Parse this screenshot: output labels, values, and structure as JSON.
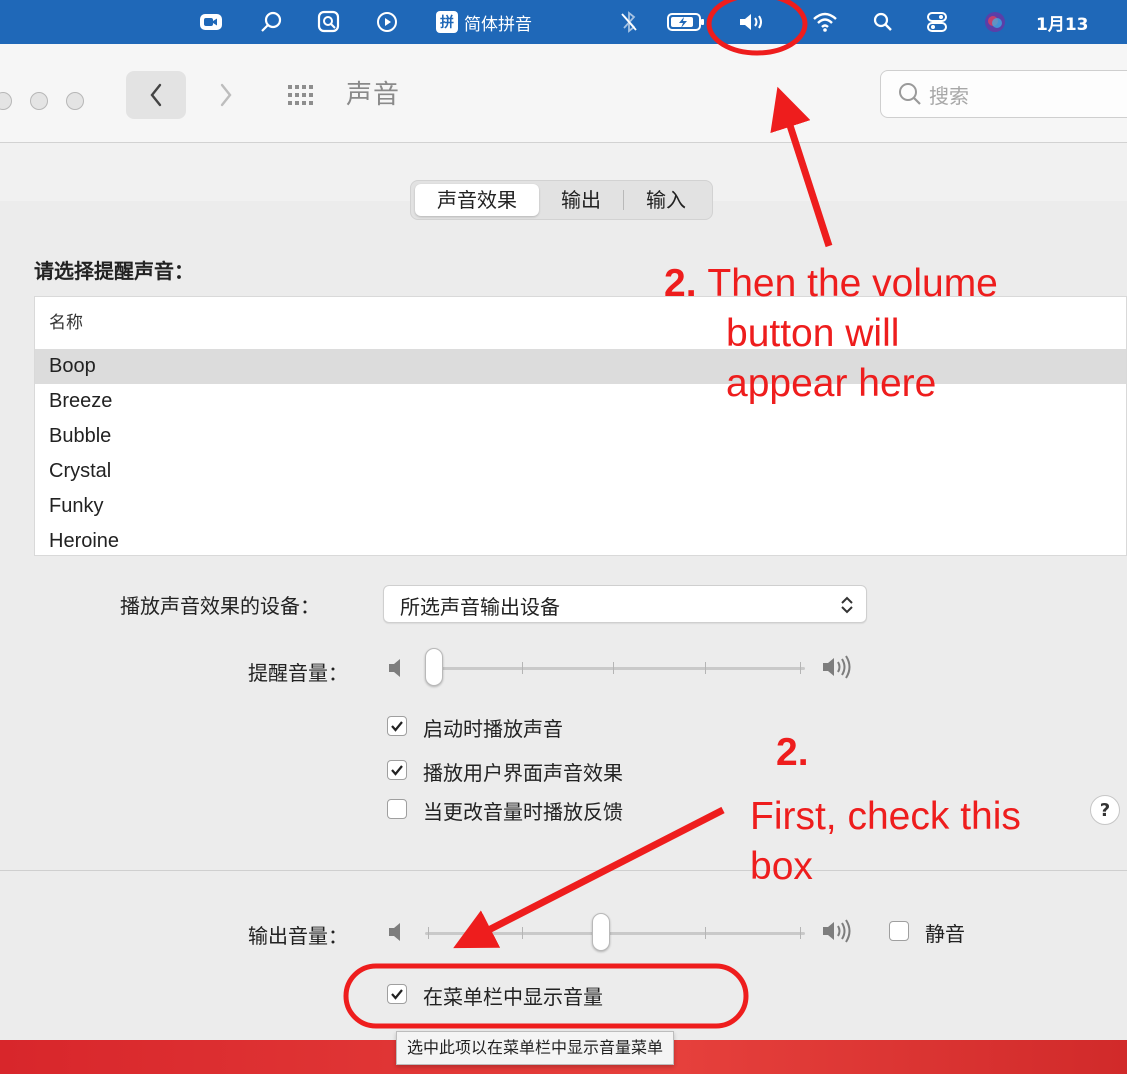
{
  "menubar": {
    "ime_badge": "拼",
    "ime_label": "简体拼音",
    "clock": "1月13"
  },
  "window": {
    "title": "声音",
    "search_placeholder": "搜索"
  },
  "tabs": [
    {
      "label": "声音效果",
      "active": true
    },
    {
      "label": "输出",
      "active": false
    },
    {
      "label": "输入",
      "active": false
    }
  ],
  "alert_section": {
    "label": "请选择提醒声音：",
    "column_header": "名称",
    "sounds": [
      "Boop",
      "Breeze",
      "Bubble",
      "Crystal",
      "Funky",
      "Heroine"
    ],
    "selected": "Boop"
  },
  "playback_device": {
    "label": "播放声音效果的设备：",
    "value": "所选声音输出设备"
  },
  "alert_volume": {
    "label": "提醒音量：",
    "level": 0.0
  },
  "checkboxes": [
    {
      "label": "启动时播放声音",
      "checked": true
    },
    {
      "label": "播放用户界面声音效果",
      "checked": true
    },
    {
      "label": "当更改音量时播放反馈",
      "checked": false
    }
  ],
  "output_volume": {
    "label": "输出音量：",
    "level": 0.46,
    "mute_label": "静音",
    "mute_checked": false
  },
  "menubar_checkbox": {
    "label": "在菜单栏中显示音量",
    "checked": true
  },
  "tooltip": "选中此项以在菜单栏中显示音量菜单",
  "help_symbol": "?",
  "annotations": {
    "top_number": "2.",
    "top_text_lines": [
      "Then the volume",
      "button will",
      "appear here"
    ],
    "bottom_number": "2.",
    "bottom_text_lines": [
      "First, check this",
      "box"
    ],
    "color": "#ee1d1d"
  },
  "colors": {
    "menubar": "#1f68b8",
    "window_bg": "#ececec",
    "selection": "#dcdcdc",
    "annotation": "#ee1d1d"
  }
}
